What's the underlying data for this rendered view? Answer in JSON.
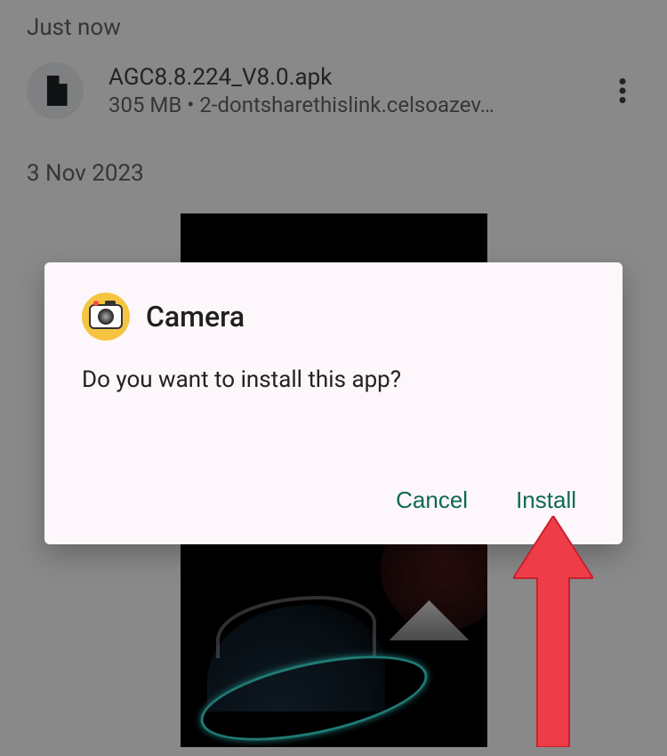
{
  "sections": {
    "recent": {
      "label": "Just now"
    },
    "older": {
      "label": "3 Nov 2023"
    }
  },
  "file": {
    "name": "AGC8.8.224_V8.0.apk",
    "size": "305 MB",
    "source": "2-dontsharethislink.celsoazev…",
    "separator": " • "
  },
  "dialog": {
    "app_name": "Camera",
    "message": "Do you want to install this app?",
    "cancel_label": "Cancel",
    "install_label": "Install"
  },
  "colors": {
    "action": "#0d6b4f",
    "arrow": "#ee3d48"
  }
}
